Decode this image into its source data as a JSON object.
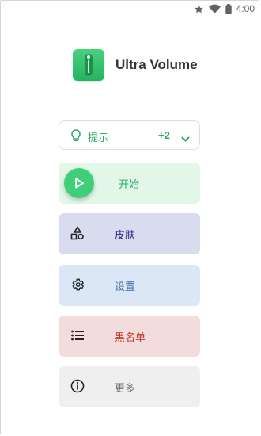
{
  "status_bar": {
    "time": "4:00",
    "icons": [
      "star-icon",
      "wifi-icon",
      "battery-icon"
    ]
  },
  "app": {
    "title": "Ultra Volume",
    "icon": "volume-slider-icon"
  },
  "hint": {
    "label": "提示",
    "count": "+2",
    "icon": "lightbulb-icon"
  },
  "menu": {
    "start": {
      "label": "开始",
      "icon": "play-icon"
    },
    "skin": {
      "label": "皮肤",
      "icon": "shapes-icon"
    },
    "settings": {
      "label": "设置",
      "icon": "gear-icon"
    },
    "blacklist": {
      "label": "黑名单",
      "icon": "list-icon"
    },
    "more": {
      "label": "更多",
      "icon": "info-icon"
    }
  },
  "colors": {
    "accent": "#3ecf77",
    "start_bg": "#e3f7e8",
    "skin_bg": "#d9dbef",
    "settings_bg": "#dce7f6",
    "blacklist_bg": "#f3dcdc",
    "more_bg": "#efefef"
  }
}
